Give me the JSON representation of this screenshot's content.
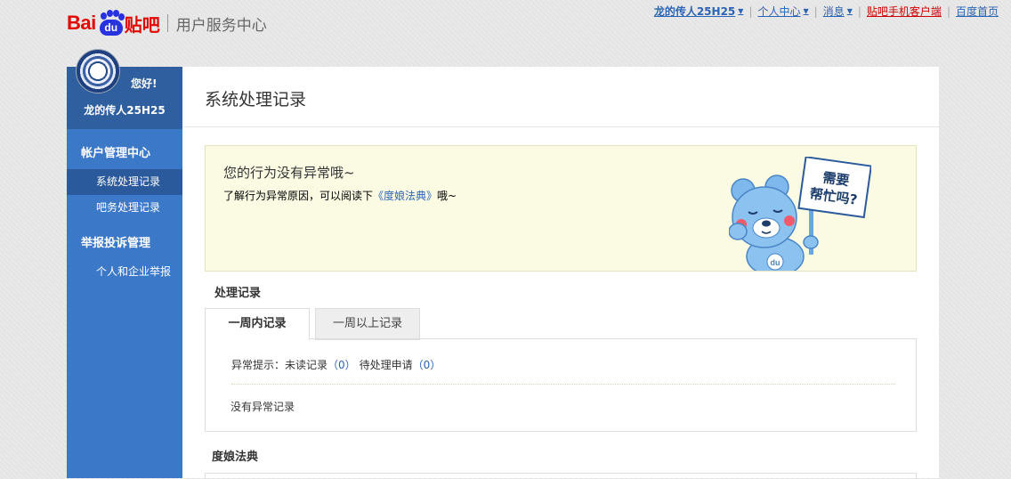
{
  "header": {
    "logo_bai": "Bai",
    "logo_du": "du",
    "logo_tieba": "贴吧",
    "logo_sub": "用户服务中心"
  },
  "topnav": {
    "username": "龙的传人25H25",
    "personal_center": "个人中心",
    "messages": "消息",
    "mobile_client": "贴吧手机客户端",
    "baidu_home": "百度首页"
  },
  "sidebar": {
    "greeting": "您好!",
    "username": "龙的传人25H25",
    "groups": [
      {
        "label": "帐户管理中心",
        "items": [
          {
            "label": "系统处理记录"
          },
          {
            "label": "吧务处理记录"
          }
        ]
      },
      {
        "label": "举报投诉管理",
        "items": [
          {
            "label": "个人和企业举报"
          }
        ]
      }
    ]
  },
  "main": {
    "title": "系统处理记录",
    "notice": {
      "heading": "您的行为没有异常哦~",
      "text_prefix": "了解行为异常原因，可以阅读下",
      "link": "《度娘法典》",
      "text_suffix": "哦~",
      "sign_line1": "需要",
      "sign_line2": "帮忙吗?"
    },
    "records_title": "处理记录",
    "tabs": [
      {
        "label": "一周内记录"
      },
      {
        "label": "一周以上记录"
      }
    ],
    "status": {
      "prefix": "异常提示：未读记录",
      "unread": "（0）",
      "pending_label": "待处理申请",
      "pending": "（0）"
    },
    "empty": "没有异常记录",
    "law_title": "度娘法典"
  }
}
